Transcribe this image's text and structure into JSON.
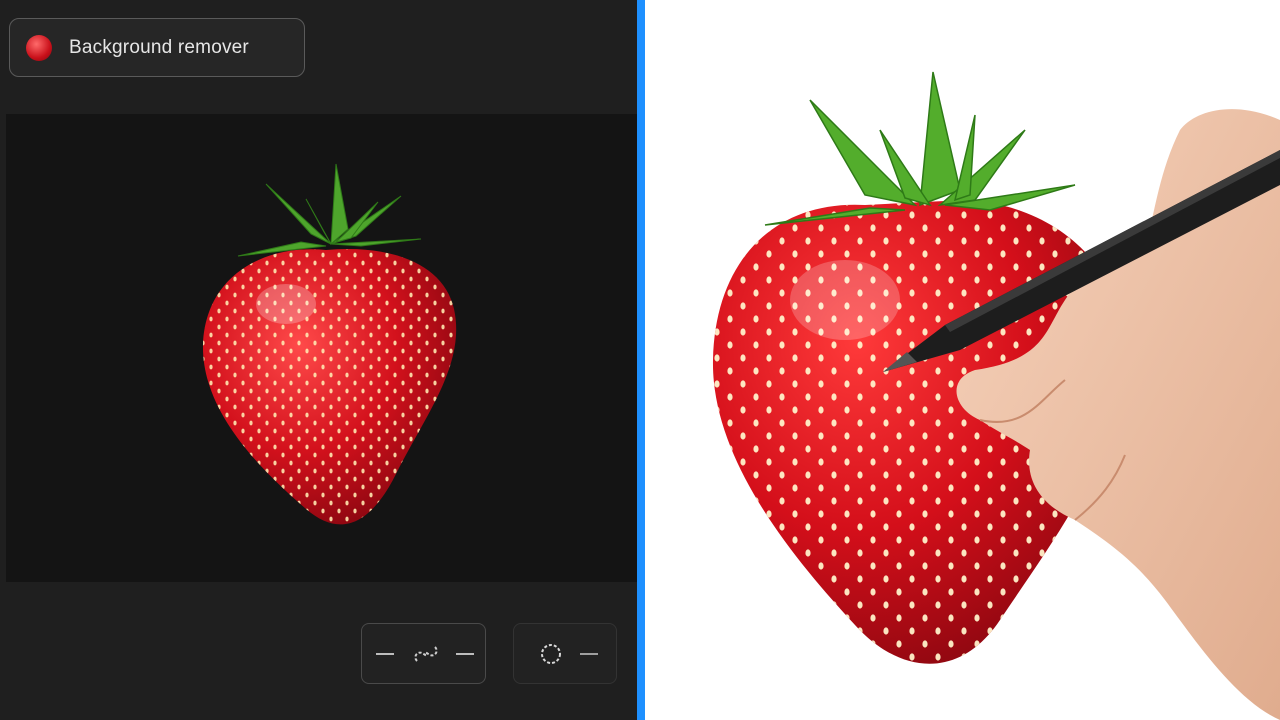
{
  "app": {
    "title": "Background remover",
    "title_icon": "strawberry-dot-icon"
  },
  "colors": {
    "accent_divider": "#1e90ff",
    "panel_dark": "#1f1f1f",
    "canvas_dark": "#141414"
  },
  "toolbar": {
    "group1": {
      "icons": [
        "minus-icon",
        "link-icon",
        "more-icon"
      ]
    },
    "group2": {
      "icons": [
        "brush-icon",
        "options-icon"
      ]
    }
  }
}
